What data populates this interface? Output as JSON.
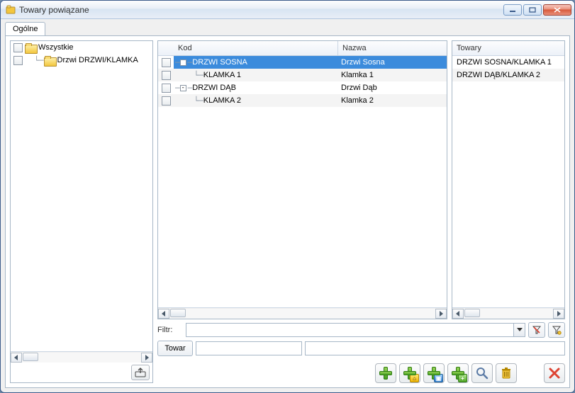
{
  "window": {
    "title": "Towary powiązane"
  },
  "tabs": {
    "general": "Ogólne"
  },
  "left_tree": {
    "root_label": "Wszystkie",
    "child_label": "Drzwi  DRZWI/KLAMKA"
  },
  "mid": {
    "col_kod": "Kod",
    "col_nazwa": "Nazwa",
    "rows": [
      {
        "code": "DRZWI SOSNA",
        "name": "Drzwi Sosna",
        "indent": 0,
        "expand": "-",
        "selected": true
      },
      {
        "code": "KLAMKA 1",
        "name": "Klamka 1",
        "indent": 1,
        "expand": "",
        "selected": false
      },
      {
        "code": "DRZWI DĄB",
        "name": "Drzwi Dąb",
        "indent": 0,
        "expand": "-",
        "selected": false
      },
      {
        "code": "KLAMKA 2",
        "name": "Klamka 2",
        "indent": 1,
        "expand": "",
        "selected": false
      }
    ]
  },
  "right": {
    "header": "Towary",
    "items": [
      "DRZWI SOSNA/KLAMKA 1",
      "DRZWI DĄB/KLAMKA 2"
    ]
  },
  "filter": {
    "label": "Filtr:"
  },
  "towar": {
    "label": "Towar"
  }
}
